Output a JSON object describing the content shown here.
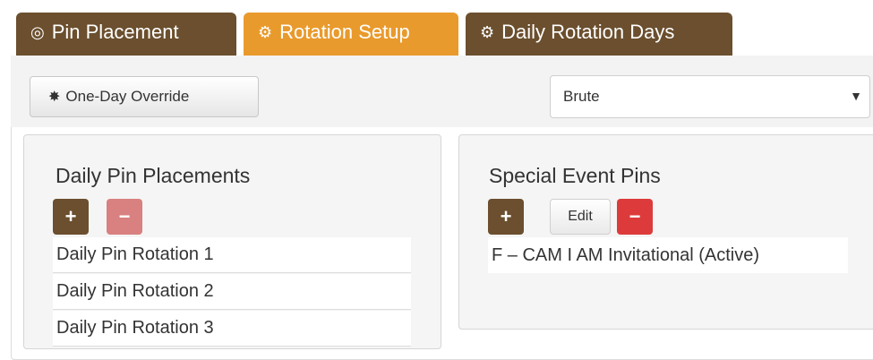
{
  "tabs": [
    {
      "label": "Pin Placement",
      "icon": "target-icon",
      "glyph": "◎"
    },
    {
      "label": "Rotation Setup",
      "icon": "gears-icon",
      "glyph": "⚙",
      "active": true
    },
    {
      "label": "Daily Rotation Days",
      "icon": "gears-icon",
      "glyph": "⚙"
    }
  ],
  "toolbar": {
    "override_label": "One-Day Override",
    "override_glyph": "✸",
    "select_value": "Brute",
    "select_caret": "▼"
  },
  "daily": {
    "title": "Daily Pin Placements",
    "add_glyph": "+",
    "remove_glyph": "−",
    "items": [
      "Daily Pin Rotation 1",
      "Daily Pin Rotation 2",
      "Daily Pin Rotation 3"
    ]
  },
  "special": {
    "title": "Special Event Pins",
    "add_glyph": "+",
    "edit_label": "Edit",
    "remove_glyph": "−",
    "items": [
      "F – CAM I AM Invitational (Active)"
    ]
  },
  "colors": {
    "brown": "#6b4f2e",
    "orange": "#e99a2c",
    "red": "#dd3b3b",
    "pink": "#d98080"
  }
}
